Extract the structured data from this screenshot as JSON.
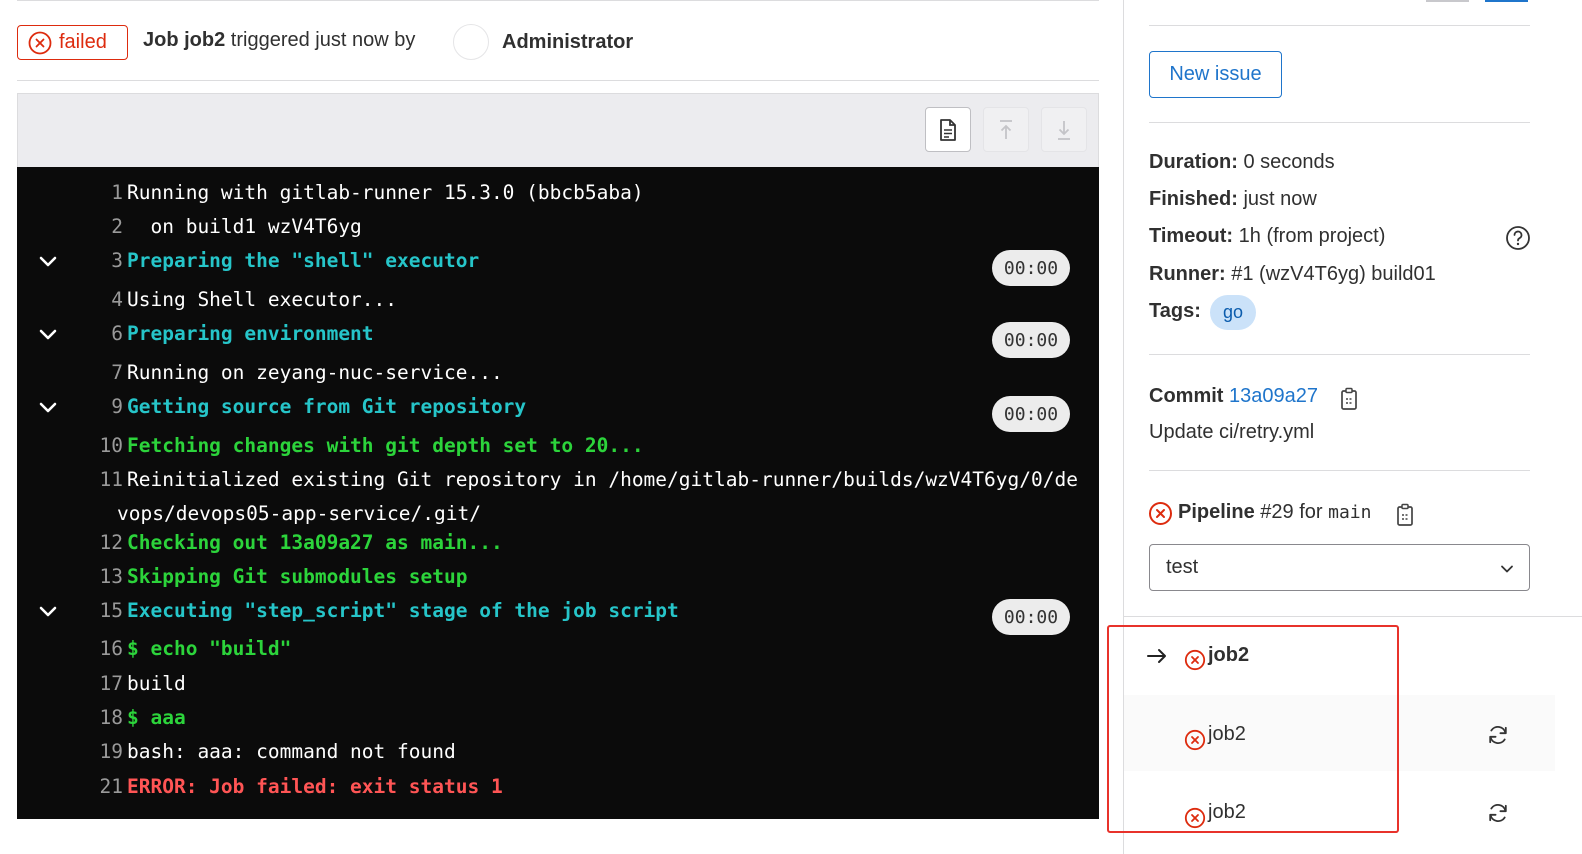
{
  "header": {
    "status": "failed",
    "job_prefix": "Job job2",
    "triggered_text": "triggered just now by",
    "user": "Administrator"
  },
  "toolbar": {
    "icons": [
      "raw-log-icon",
      "scroll-top-icon",
      "scroll-bottom-icon"
    ]
  },
  "log": {
    "lines": [
      {
        "num": "1",
        "text": "Running with gitlab-runner 15.3.0 (bbcb5aba)",
        "style": "plain"
      },
      {
        "num": "2",
        "text": "  on build1 wzV4T6yg",
        "style": "plain"
      },
      {
        "num": "3",
        "text": "Preparing the \"shell\" executor",
        "style": "section",
        "duration": "00:00"
      },
      {
        "num": "4",
        "text": "Using Shell executor...",
        "style": "plain"
      },
      {
        "num": "6",
        "text": "Preparing environment",
        "style": "section",
        "duration": "00:00"
      },
      {
        "num": "7",
        "text": "Running on zeyang-nuc-service...",
        "style": "plain"
      },
      {
        "num": "9",
        "text": "Getting source from Git repository",
        "style": "section",
        "duration": "00:00"
      },
      {
        "num": "10",
        "text": "Fetching changes with git depth set to 20...",
        "style": "green"
      },
      {
        "num": "11",
        "text": "Reinitialized existing Git repository in /home/gitlab-runner/builds/wzV4T6yg/0/de",
        "wrap": "vops/devops05-app-service/.git/",
        "style": "plain"
      },
      {
        "num": "12",
        "text": "Checking out 13a09a27 as main...",
        "style": "green"
      },
      {
        "num": "13",
        "text": "Skipping Git submodules setup",
        "style": "green"
      },
      {
        "num": "15",
        "text": "Executing \"step_script\" stage of the job script",
        "style": "section",
        "duration": "00:00"
      },
      {
        "num": "16",
        "text": "$ echo \"build\"",
        "style": "green"
      },
      {
        "num": "17",
        "text": "build",
        "style": "plain"
      },
      {
        "num": "18",
        "text": "$ aaa",
        "style": "green"
      },
      {
        "num": "19",
        "text": "bash: aaa: command not found",
        "style": "plain"
      },
      {
        "num": "21",
        "text": "ERROR: Job failed: exit status 1",
        "style": "red"
      }
    ]
  },
  "sidebar": {
    "new_issue": "New issue",
    "duration_label": "Duration:",
    "duration_value": "0 seconds",
    "finished_label": "Finished:",
    "finished_value": "just now",
    "timeout_label": "Timeout:",
    "timeout_value": "1h (from project)",
    "runner_label": "Runner:",
    "runner_value": "#1 (wzV4T6yg) build01",
    "tags_label": "Tags:",
    "tag": "go",
    "commit_label": "Commit",
    "commit_sha": "13a09a27",
    "commit_message": "Update ci/retry.yml",
    "pipeline_label": "Pipeline",
    "pipeline_id": "#29",
    "pipeline_for": "for",
    "pipeline_ref": "main",
    "stage_selected": "test",
    "jobs": [
      {
        "name": "job2",
        "current": true
      },
      {
        "name": "job2",
        "current": false
      },
      {
        "name": "job2",
        "current": false
      }
    ]
  },
  "colors": {
    "failed_red": "#dd2b0e",
    "link_blue": "#1f75cb",
    "log_cyan": "#26c5c9",
    "log_green": "#2cd43b",
    "log_red": "#ff5555",
    "highlight_red": "#e8322b"
  }
}
